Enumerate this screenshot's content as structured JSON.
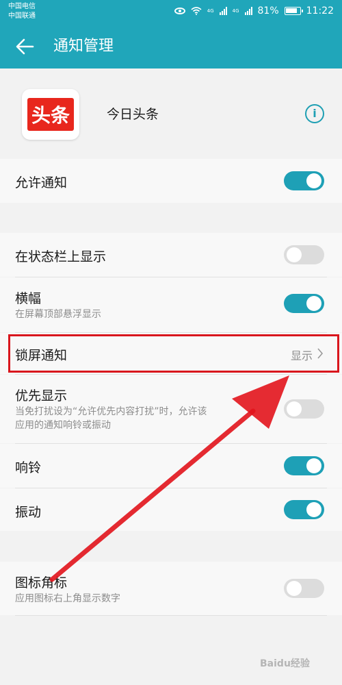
{
  "status_bar": {
    "carrier_1": "中国电信",
    "carrier_2": "中国联通",
    "net_1": "4G",
    "net_2": "4G",
    "battery": "81%",
    "time": "11:22"
  },
  "app_bar": {
    "title": "通知管理"
  },
  "app": {
    "logo_text": "头条",
    "name": "今日头条"
  },
  "settings": {
    "allow_notifications": {
      "label": "允许通知",
      "enabled": true
    },
    "status_bar_display": {
      "label": "在状态栏上显示",
      "enabled": false
    },
    "banner": {
      "label": "横幅",
      "subtitle": "在屏幕顶部悬浮显示",
      "enabled": true
    },
    "lock_screen": {
      "label": "锁屏通知",
      "value": "显示"
    },
    "priority_display": {
      "label": "优先显示",
      "subtitle_line1": "当免打扰设为“允许优先内容打扰”时，允许该",
      "subtitle_line2": "应用的通知响铃或振动",
      "enabled": false
    },
    "ringtone": {
      "label": "响铃",
      "enabled": true
    },
    "vibration": {
      "label": "振动",
      "enabled": true
    },
    "badge": {
      "label": "图标角标",
      "subtitle": "应用图标右上角显示数字",
      "enabled": false
    }
  },
  "watermark": "Baidu经验",
  "colors": {
    "accent": "#20a6ba",
    "toggle_on": "#1ea0b6",
    "toggle_off": "#dcdcdc",
    "highlight": "#d9161d",
    "logo_red": "#e8271d"
  }
}
